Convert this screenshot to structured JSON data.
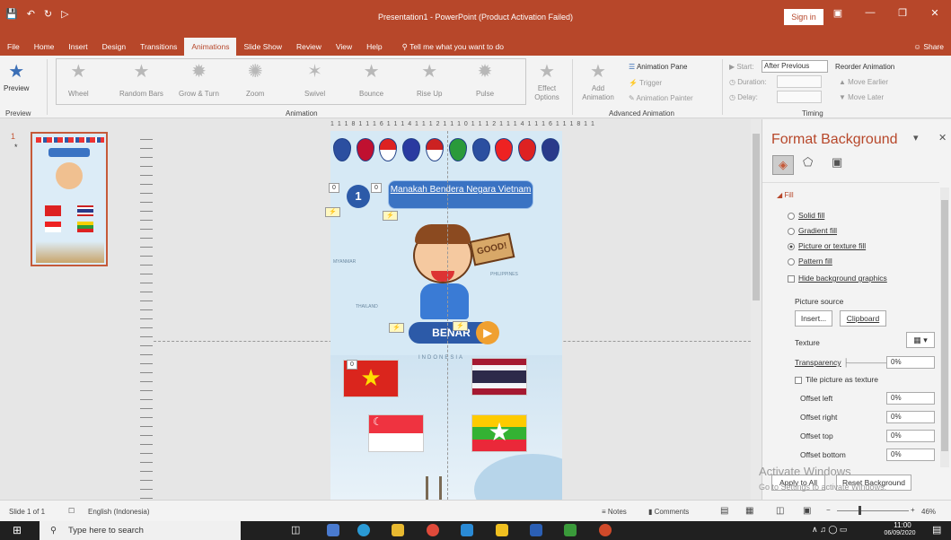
{
  "window": {
    "title": "Presentation1 - PowerPoint (Product Activation Failed)",
    "sign_in": "Sign in"
  },
  "menu": {
    "tabs": [
      "File",
      "Home",
      "Insert",
      "Design",
      "Transitions",
      "Animations",
      "Slide Show",
      "Review",
      "View",
      "Help"
    ],
    "active": "Animations",
    "tell_me": "Tell me what you want to do",
    "share": "Share"
  },
  "ribbon": {
    "preview": "Preview",
    "preview_group": "Preview",
    "animations": [
      "Wheel",
      "Random Bars",
      "Grow & Turn",
      "Zoom",
      "Swivel",
      "Bounce",
      "Rise Up",
      "Pulse"
    ],
    "effect_options": "Effect Options",
    "animation_group": "Animation",
    "add_animation": "Add Animation",
    "animation_pane": "Animation Pane",
    "trigger": "Trigger",
    "animation_painter": "Animation Painter",
    "advanced_group": "Advanced Animation",
    "start_label": "Start:",
    "start_value": "After Previous",
    "duration_label": "Duration:",
    "delay_label": "Delay:",
    "reorder": "Reorder Animation",
    "move_earlier": "Move Earlier",
    "move_later": "Move Later",
    "timing_group": "Timing"
  },
  "slide_panel": {
    "number": "1",
    "star": "*"
  },
  "slide": {
    "ruler": "1 1 1 8 1 1 1 6 1 1 1 4 1 1 1 2 1 1 1 0 1 1 1 2 1 1 1 4 1 1 1 6 1 1 1 8 1 1",
    "number": "1",
    "title": "Manakah Bendera Negara Vietnam",
    "good": "GOOD!",
    "benar": "BENAR",
    "tag_zero": "0",
    "map_label_1": "MYANMAR",
    "map_label_2": "THAILAND",
    "map_label_3": "PHILIPPINES",
    "map_label_4": "INDONESIA"
  },
  "pane": {
    "title": "Format Background",
    "fill": "Fill",
    "solid": "Solid fill",
    "gradient": "Gradient fill",
    "picture": "Picture or texture fill",
    "pattern": "Pattern fill",
    "hide_bg": "Hide background graphics",
    "picture_source": "Picture source",
    "insert": "Insert...",
    "clipboard": "Clipboard",
    "texture": "Texture",
    "transparency": "Transparency",
    "transparency_value": "0%",
    "tile": "Tile picture as texture",
    "offset_left": "Offset left",
    "offset_right": "Offset right",
    "offset_top": "Offset top",
    "offset_bottom": "Offset bottom",
    "offset_value": "0%",
    "apply_all": "Apply to All",
    "reset": "Reset Background",
    "watermark1": "Activate Windows",
    "watermark2": "Go to Settings to activate Windows."
  },
  "status": {
    "slide": "Slide 1 of 1",
    "language": "English (Indonesia)",
    "notes": "Notes",
    "comments": "Comments",
    "zoom": "46%"
  },
  "taskbar": {
    "search": "Type here to search",
    "time": "11:00",
    "date": "06/09/2020"
  }
}
